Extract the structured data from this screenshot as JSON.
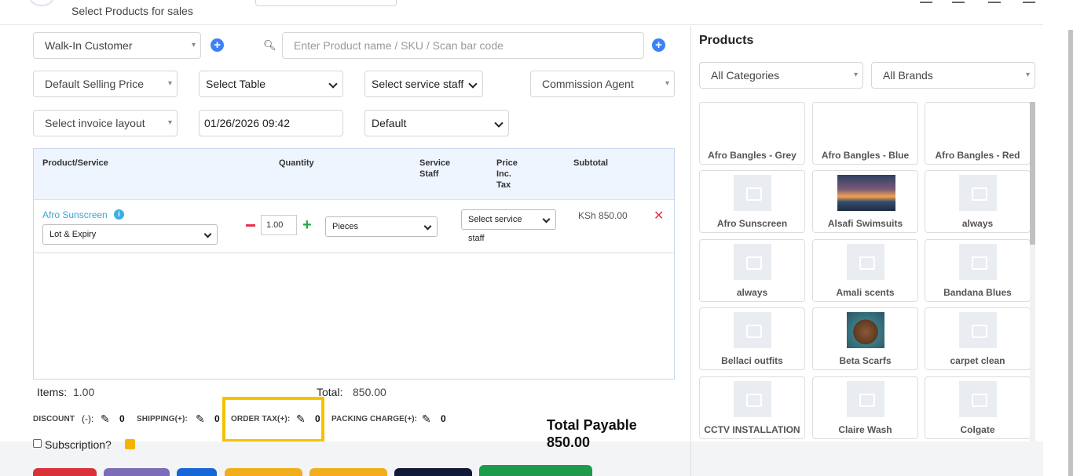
{
  "header": {
    "subtitle": "Select Products for sales"
  },
  "form": {
    "customer": "Walk-In Customer",
    "product_search_placeholder": "Enter Product name / SKU / Scan bar code",
    "price_group": "Default Selling Price",
    "table": "Select Table",
    "service_staff": "Select service staff",
    "commission_agent": "Commission Agent",
    "invoice_layout": "Select invoice layout",
    "transaction_date": "01/26/2026 09:42",
    "invoice_scheme": "Default"
  },
  "table": {
    "headers": {
      "product": "Product/Service",
      "quantity": "Quantity",
      "service_staff": "Service Staff",
      "price": "Price Inc. Tax",
      "subtotal": "Subtotal"
    },
    "rows": [
      {
        "name": "Afro Sunscreen",
        "lot": "Lot & Expiry",
        "qty": "1.00",
        "unit": "Pieces",
        "staff": "Select service staff",
        "subtotal": "KSh 850.00"
      }
    ]
  },
  "totals": {
    "items_label": "Items:",
    "items_value": "1.00",
    "total_label": "Total:",
    "total_value": "850.00",
    "discount_label": "DISCOUNT",
    "discount_sign": "(-):",
    "discount_value": "0",
    "shipping_label": "SHIPPING(+):",
    "shipping_value": "0",
    "order_tax_label": "ORDER TAX(+):",
    "order_tax_value": "0",
    "packing_label": "PACKING CHARGE(+):",
    "packing_value": "0",
    "total_payable_label": "Total Payable",
    "total_payable_value": "850.00",
    "subscription_label": "Subscription?"
  },
  "products_panel": {
    "title": "Products",
    "category": "All Categories",
    "brand": "All Brands",
    "items": [
      {
        "name": "Afro Bangles - Grey",
        "thumb": "none"
      },
      {
        "name": "Afro Bangles - Blue",
        "thumb": "none"
      },
      {
        "name": "Afro Bangles - Red",
        "thumb": "none"
      },
      {
        "name": "Afro Sunscreen",
        "thumb": "placeholder"
      },
      {
        "name": "Alsafi Swimsuits",
        "thumb": "sunset-photo"
      },
      {
        "name": "always",
        "thumb": "placeholder"
      },
      {
        "name": "always",
        "thumb": "placeholder"
      },
      {
        "name": "Amali scents",
        "thumb": "placeholder"
      },
      {
        "name": "Bandana Blues",
        "thumb": "placeholder"
      },
      {
        "name": "Bellaci outfits",
        "thumb": "placeholder"
      },
      {
        "name": "Beta Scarfs",
        "thumb": "portrait-photo"
      },
      {
        "name": "carpet clean",
        "thumb": "placeholder"
      },
      {
        "name": "CCTV INSTALLATION",
        "thumb": "placeholder"
      },
      {
        "name": "Claire Wash",
        "thumb": "placeholder"
      },
      {
        "name": "Colgate",
        "thumb": "placeholder"
      }
    ]
  },
  "colors": {
    "accent_blue": "#3b82f6",
    "highlight": "#f5c200",
    "link": "#39a5d8",
    "danger": "#e0344a",
    "success": "#28a745"
  }
}
